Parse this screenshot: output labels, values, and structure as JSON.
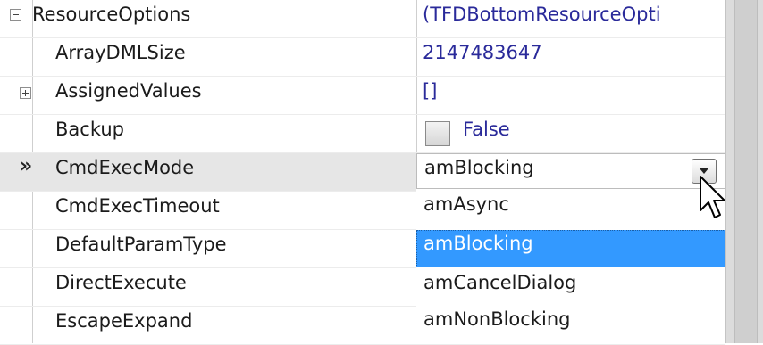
{
  "properties": [
    {
      "name": "ResourceOptions",
      "value": "(TFDBottomResourceOpti",
      "expander": "minus",
      "level": "top"
    },
    {
      "name": "ArrayDMLSize",
      "value": "2147483647"
    },
    {
      "name": "AssignedValues",
      "value": "[]",
      "expander": "plus"
    },
    {
      "name": "Backup",
      "value": "False",
      "checkbox": true
    },
    {
      "name": "CmdExecMode",
      "value": "amBlocking",
      "selected": true,
      "marker": "»"
    },
    {
      "name": "CmdExecTimeout"
    },
    {
      "name": "DefaultParamType"
    },
    {
      "name": "DirectExecute"
    },
    {
      "name": "EscapeExpand"
    }
  ],
  "dropdown": {
    "options": [
      "amAsync",
      "amBlocking",
      "amCancelDialog",
      "amNonBlocking"
    ],
    "highlighted_index": 1,
    "open": true
  },
  "colors": {
    "value_text": "#2a2a9a",
    "selected_row": "#e6e6e6",
    "highlight": "#3399ff"
  },
  "icons": {
    "collapse": "minus-box-icon",
    "expand": "plus-box-icon",
    "row_marker": "double-chevron-right-icon",
    "dropdown": "chevron-down-icon",
    "cursor": "arrow-cursor-icon"
  }
}
